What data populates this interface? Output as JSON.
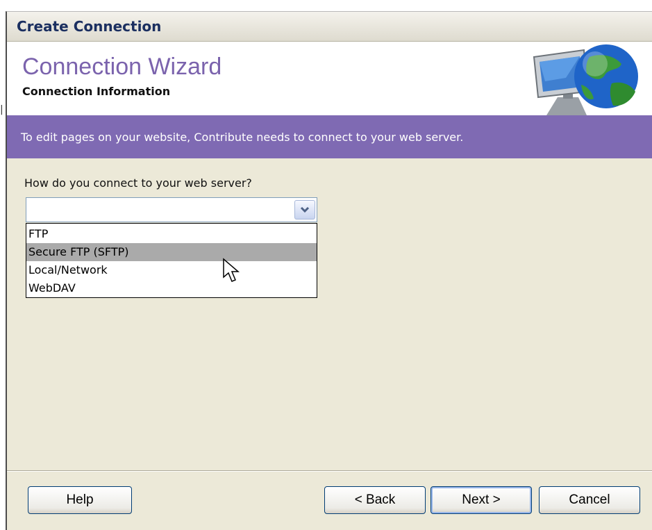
{
  "window": {
    "title": "Create Connection"
  },
  "header": {
    "wizard_title": "Connection Wizard",
    "step_title": "Connection Information"
  },
  "band": {
    "text": "To edit pages on your website, Contribute needs to connect to your web server."
  },
  "form": {
    "question": "How do you connect to your web server?",
    "selected_value": "",
    "options": [
      "FTP",
      "Secure FTP (SFTP)",
      "Local/Network",
      "WebDAV"
    ],
    "highlighted_option": "Secure FTP (SFTP)"
  },
  "buttons": {
    "help": "Help",
    "back": "< Back",
    "next": "Next >",
    "cancel": "Cancel"
  },
  "colors": {
    "accent_purple": "#7f6ab3",
    "title_purple": "#7b63ad",
    "dialog_bg": "#ece9d8"
  },
  "icons": {
    "header_art": "computer-globe-icon",
    "dropdown": "chevron-down-icon",
    "cursor": "mouse-pointer-icon"
  }
}
